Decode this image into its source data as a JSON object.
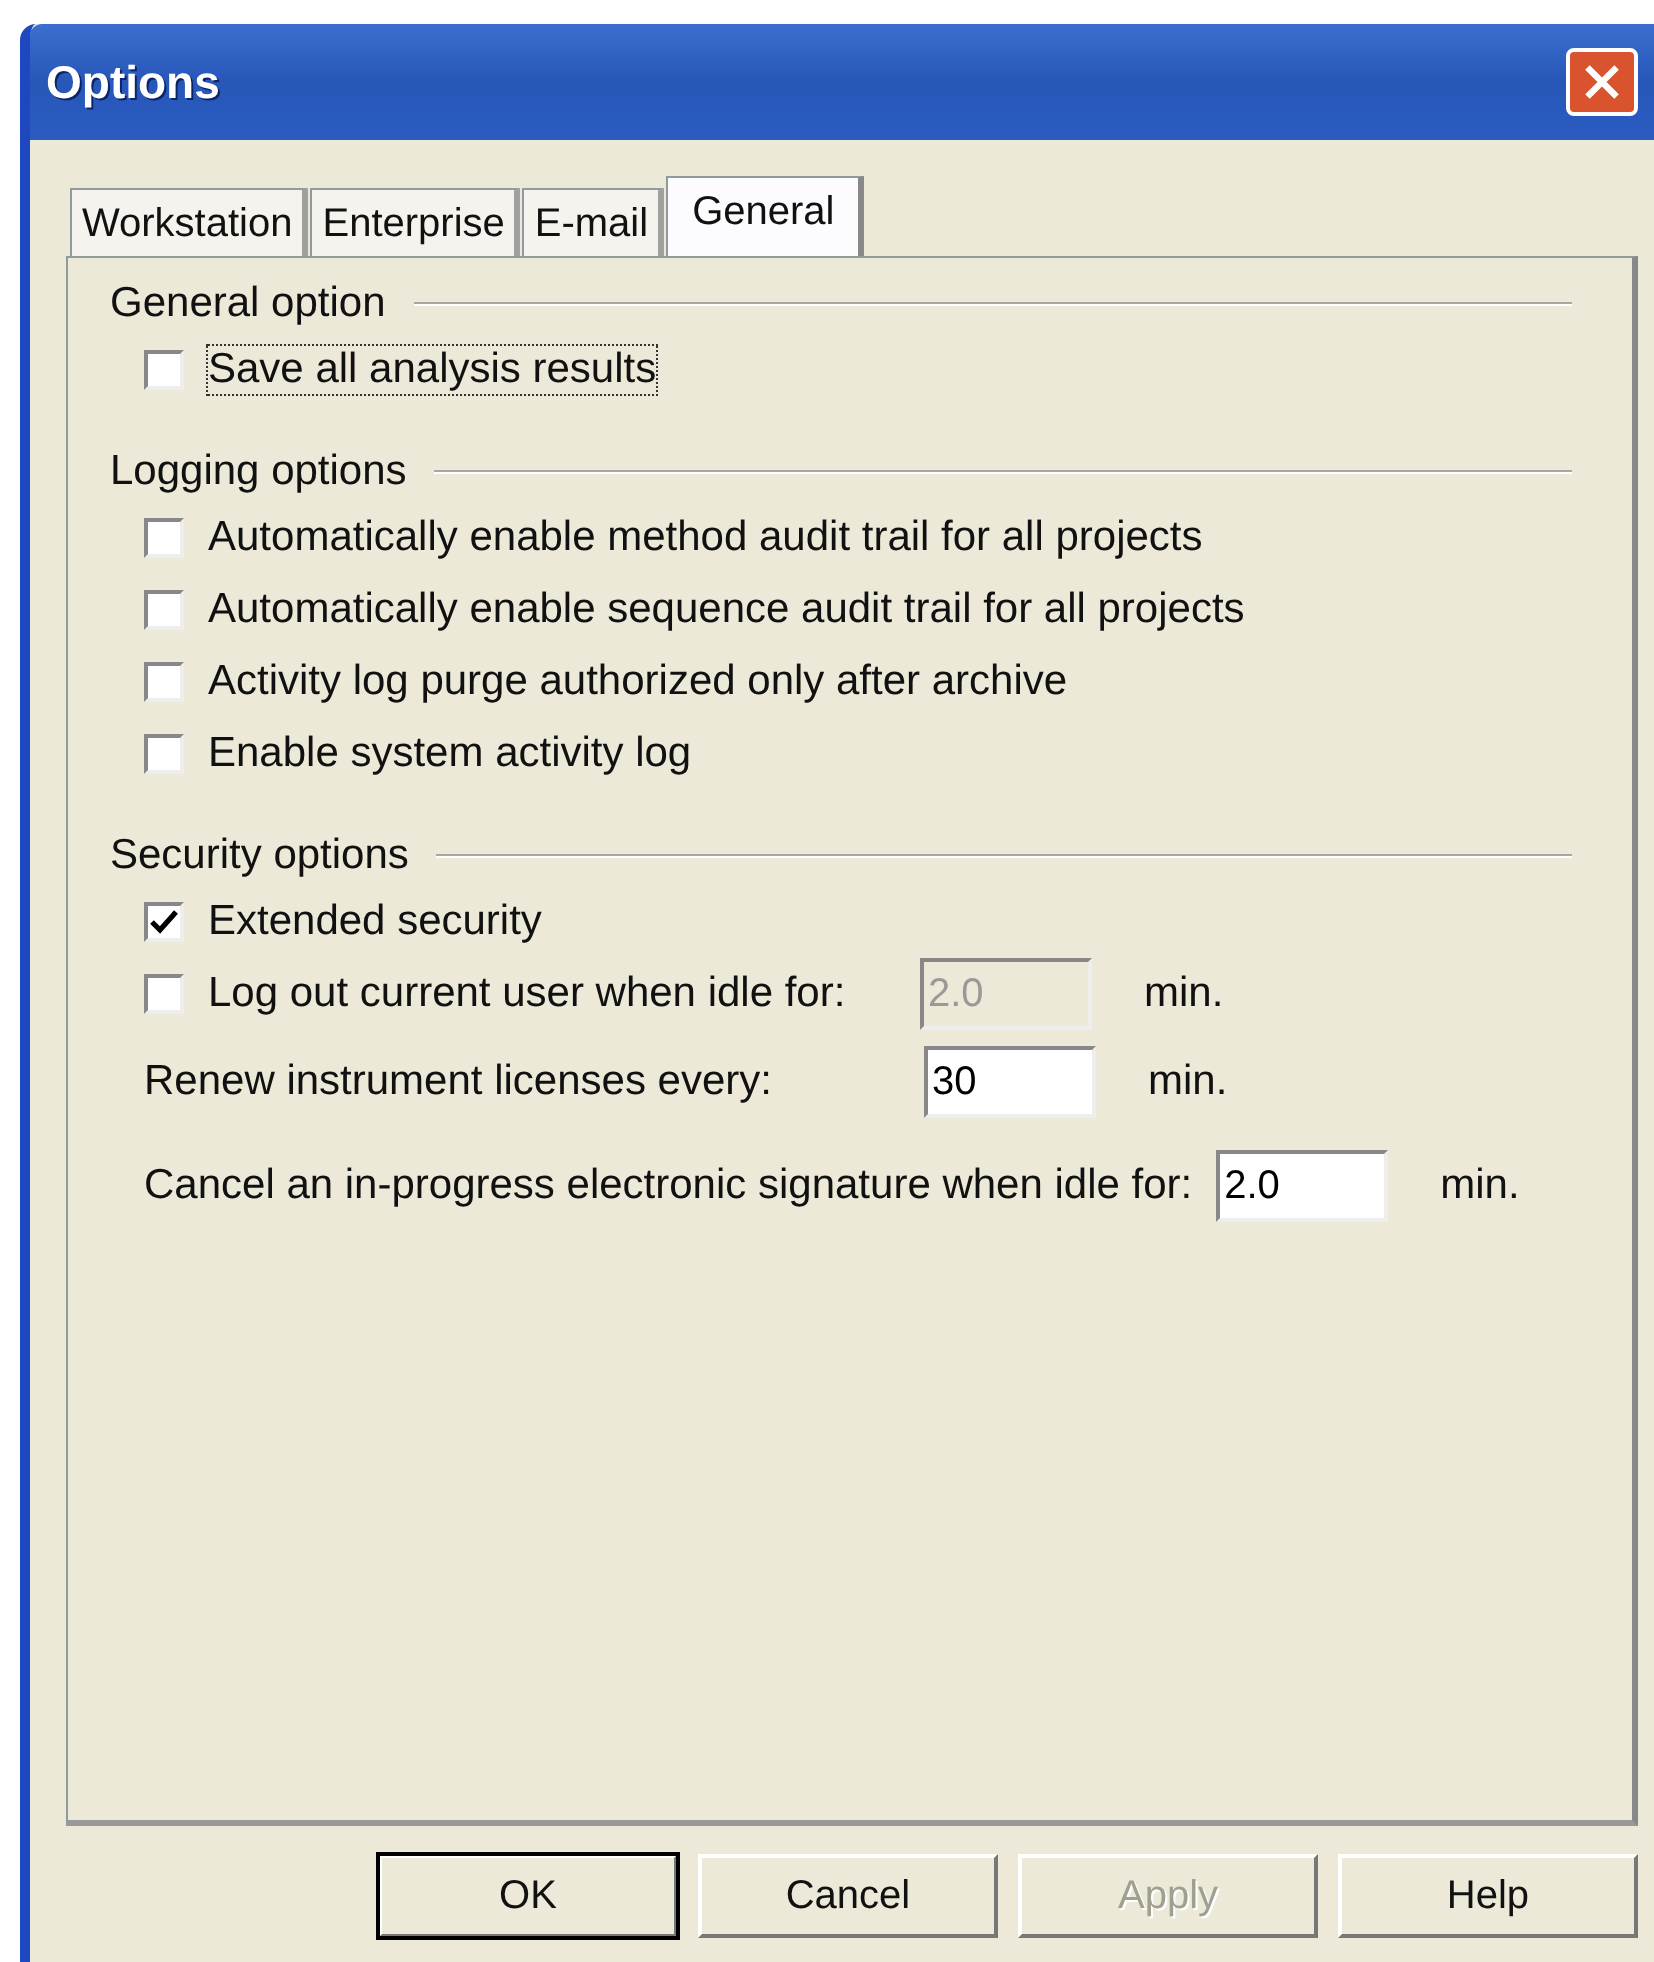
{
  "window": {
    "title": "Options"
  },
  "tabs": [
    {
      "label": "Workstation",
      "selected": false
    },
    {
      "label": "Enterprise",
      "selected": false
    },
    {
      "label": "E-mail",
      "selected": false
    },
    {
      "label": "General",
      "selected": true
    }
  ],
  "sections": [
    {
      "title": "General option",
      "items": [
        {
          "kind": "checkbox",
          "label": "Save all analysis results",
          "checked": false,
          "focused": true
        }
      ]
    },
    {
      "title": "Logging options",
      "items": [
        {
          "kind": "checkbox",
          "label": "Automatically enable method audit trail for all projects",
          "checked": false
        },
        {
          "kind": "checkbox",
          "label": "Automatically enable sequence audit trail for all projects",
          "checked": false
        },
        {
          "kind": "checkbox",
          "label": "Activity log purge authorized only after archive",
          "checked": false
        },
        {
          "kind": "checkbox",
          "label": "Enable system activity log",
          "checked": false
        }
      ]
    },
    {
      "title": "Security options",
      "items": [
        {
          "kind": "checkbox",
          "label": "Extended security",
          "checked": true
        },
        {
          "kind": "checkbox-field",
          "label": "Log out current user when idle for:",
          "checked": false,
          "value": "2.0",
          "disabled": true,
          "unit": "min."
        },
        {
          "kind": "field",
          "label": "Renew instrument licenses every:",
          "value": "30",
          "disabled": false,
          "unit": "min."
        },
        {
          "kind": "field",
          "label": "Cancel an in-progress electronic signature when idle for:",
          "value": "2.0",
          "disabled": false,
          "unit": "min."
        }
      ]
    }
  ],
  "buttons": [
    {
      "label": "OK",
      "default": true,
      "disabled": false
    },
    {
      "label": "Cancel",
      "default": false,
      "disabled": false
    },
    {
      "label": "Apply",
      "default": false,
      "disabled": true
    },
    {
      "label": "Help",
      "default": false,
      "disabled": false
    }
  ]
}
